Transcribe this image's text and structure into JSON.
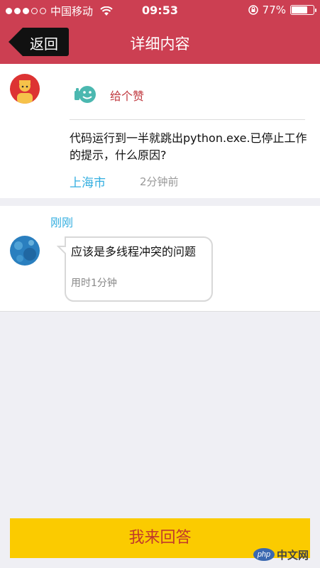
{
  "status_bar": {
    "carrier": "中国移动",
    "time": "09:53",
    "battery": "77%",
    "battery_level": 0.77,
    "signal_filled": 3,
    "signal_total": 5
  },
  "nav": {
    "back_label": "返回",
    "title": "详细内容"
  },
  "question": {
    "like_label": "给个赞",
    "text": "代码运行到一半就跳出python.exe.已停止工作的提示，什么原因?",
    "city": "上海市",
    "time": "2分钟前"
  },
  "answer": {
    "timestamp": "刚刚",
    "text": "应该是多线程冲突的问题",
    "duration": "用时1分钟"
  },
  "bottom": {
    "answer_button": "我来回答"
  },
  "watermark": {
    "logo": "php",
    "text": "中文网"
  },
  "colors": {
    "header": "#cc3f52",
    "accent_blue": "#33aee0",
    "like_red": "#c0393f",
    "button_yellow": "#fbcb00"
  }
}
